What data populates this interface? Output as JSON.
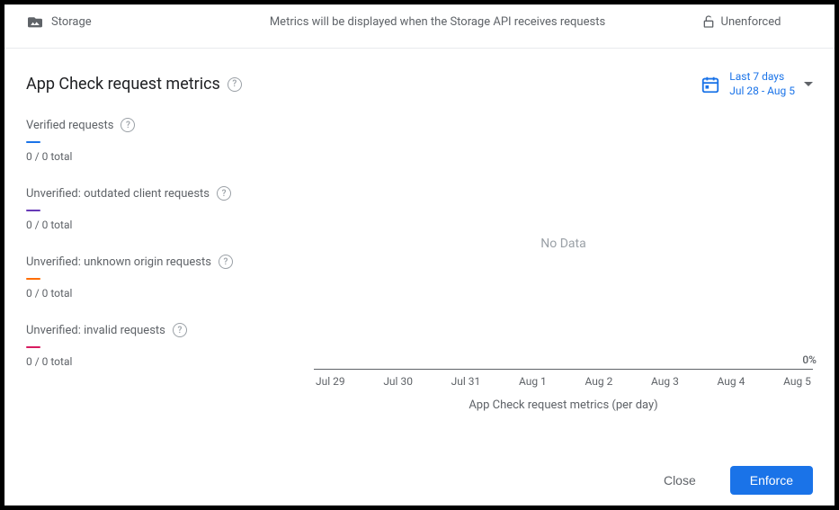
{
  "header": {
    "service_label": "Storage",
    "center_message": "Metrics will be displayed when the Storage API receives requests",
    "status_label": "Unenforced"
  },
  "title": "App Check request metrics",
  "date_range": {
    "label": "Last 7 days",
    "range": "Jul 28 - Aug 5"
  },
  "legend": [
    {
      "label": "Verified requests",
      "value": "0 / 0 total",
      "color": "#1a73e8"
    },
    {
      "label": "Unverified: outdated client requests",
      "value": "0 / 0 total",
      "color": "#673ab7"
    },
    {
      "label": "Unverified: unknown origin requests",
      "value": "0 / 0 total",
      "color": "#ff6d00"
    },
    {
      "label": "Unverified: invalid requests",
      "value": "0 / 0 total",
      "color": "#d81b60"
    }
  ],
  "chart_data": {
    "type": "line",
    "categories": [
      "Jul 29",
      "Jul 30",
      "Jul 31",
      "Aug 1",
      "Aug 2",
      "Aug 3",
      "Aug 4",
      "Aug 5"
    ],
    "series": [
      {
        "name": "Verified requests",
        "values": [
          0,
          0,
          0,
          0,
          0,
          0,
          0,
          0
        ]
      },
      {
        "name": "Unverified: outdated client requests",
        "values": [
          0,
          0,
          0,
          0,
          0,
          0,
          0,
          0
        ]
      },
      {
        "name": "Unverified: unknown origin requests",
        "values": [
          0,
          0,
          0,
          0,
          0,
          0,
          0,
          0
        ]
      },
      {
        "name": "Unverified: invalid requests",
        "values": [
          0,
          0,
          0,
          0,
          0,
          0,
          0,
          0
        ]
      }
    ],
    "no_data_label": "No Data",
    "y_zero_label": "0%",
    "caption": "App Check request metrics (per day)",
    "title": "App Check request metrics",
    "xlabel": "",
    "ylabel": "",
    "ylim": [
      0,
      100
    ]
  },
  "footer": {
    "close_label": "Close",
    "enforce_label": "Enforce"
  }
}
